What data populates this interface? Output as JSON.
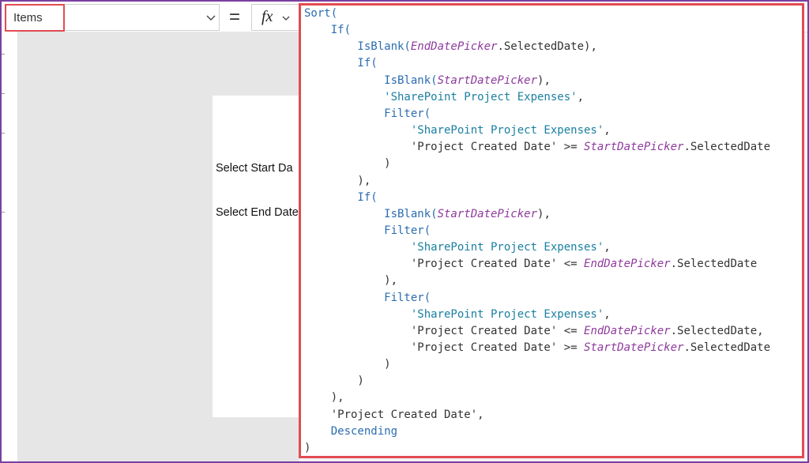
{
  "formula_bar": {
    "property_value": "Items",
    "equals": "=",
    "fx_label": "fx"
  },
  "canvas": {
    "labels": [
      "Select Start Da",
      "Select End Date"
    ]
  },
  "code": {
    "lines": [
      [
        {
          "t": "Sort(",
          "c": "kw"
        }
      ],
      [
        {
          "t": "    If(",
          "c": "kw"
        }
      ],
      [
        {
          "t": "        IsBlank(",
          "c": "kw"
        },
        {
          "t": "EndDatePicker",
          "c": "var"
        },
        {
          "t": ".SelectedDate),",
          "c": "tx"
        }
      ],
      [
        {
          "t": "        If(",
          "c": "kw"
        }
      ],
      [
        {
          "t": "            IsBlank(",
          "c": "kw"
        },
        {
          "t": "StartDatePicker",
          "c": "var"
        },
        {
          "t": "),",
          "c": "tx"
        }
      ],
      [
        {
          "t": "            'SharePoint Project Expenses'",
          "c": "str"
        },
        {
          "t": ",",
          "c": "tx"
        }
      ],
      [
        {
          "t": "            Filter(",
          "c": "kw"
        }
      ],
      [
        {
          "t": "                'SharePoint Project Expenses'",
          "c": "str"
        },
        {
          "t": ",",
          "c": "tx"
        }
      ],
      [
        {
          "t": "                'Project Created Date' >= ",
          "c": "tx"
        },
        {
          "t": "StartDatePicker",
          "c": "var"
        },
        {
          "t": ".SelectedDate",
          "c": "tx"
        }
      ],
      [
        {
          "t": "            )",
          "c": "tx"
        }
      ],
      [
        {
          "t": "        ),",
          "c": "tx"
        }
      ],
      [
        {
          "t": "        If(",
          "c": "kw"
        }
      ],
      [
        {
          "t": "            IsBlank(",
          "c": "kw"
        },
        {
          "t": "StartDatePicker",
          "c": "var"
        },
        {
          "t": "),",
          "c": "tx"
        }
      ],
      [
        {
          "t": "            Filter(",
          "c": "kw"
        }
      ],
      [
        {
          "t": "                'SharePoint Project Expenses'",
          "c": "str"
        },
        {
          "t": ",",
          "c": "tx"
        }
      ],
      [
        {
          "t": "                'Project Created Date' <= ",
          "c": "tx"
        },
        {
          "t": "EndDatePicker",
          "c": "var"
        },
        {
          "t": ".SelectedDate",
          "c": "tx"
        }
      ],
      [
        {
          "t": "            ),",
          "c": "tx"
        }
      ],
      [
        {
          "t": "            Filter(",
          "c": "kw"
        }
      ],
      [
        {
          "t": "                'SharePoint Project Expenses'",
          "c": "str"
        },
        {
          "t": ",",
          "c": "tx"
        }
      ],
      [
        {
          "t": "                'Project Created Date' <= ",
          "c": "tx"
        },
        {
          "t": "EndDatePicker",
          "c": "var"
        },
        {
          "t": ".SelectedDate,",
          "c": "tx"
        }
      ],
      [
        {
          "t": "                'Project Created Date' >= ",
          "c": "tx"
        },
        {
          "t": "StartDatePicker",
          "c": "var"
        },
        {
          "t": ".SelectedDate",
          "c": "tx"
        }
      ],
      [
        {
          "t": "            )",
          "c": "tx"
        }
      ],
      [
        {
          "t": "        )",
          "c": "tx"
        }
      ],
      [
        {
          "t": "    ),",
          "c": "tx"
        }
      ],
      [
        {
          "t": "    'Project Created Date'",
          "c": "tx"
        },
        {
          "t": ",",
          "c": "tx"
        }
      ],
      [
        {
          "t": "    Descending",
          "c": "kw"
        }
      ],
      [
        {
          "t": ")",
          "c": "tx"
        }
      ]
    ]
  },
  "colors": {
    "keyword": "#2b6cb0",
    "variable": "#8e3a9d",
    "string": "#1a7fa0",
    "text": "#333333",
    "highlight_border": "#e24b52",
    "window_border": "#7a3fa0"
  }
}
